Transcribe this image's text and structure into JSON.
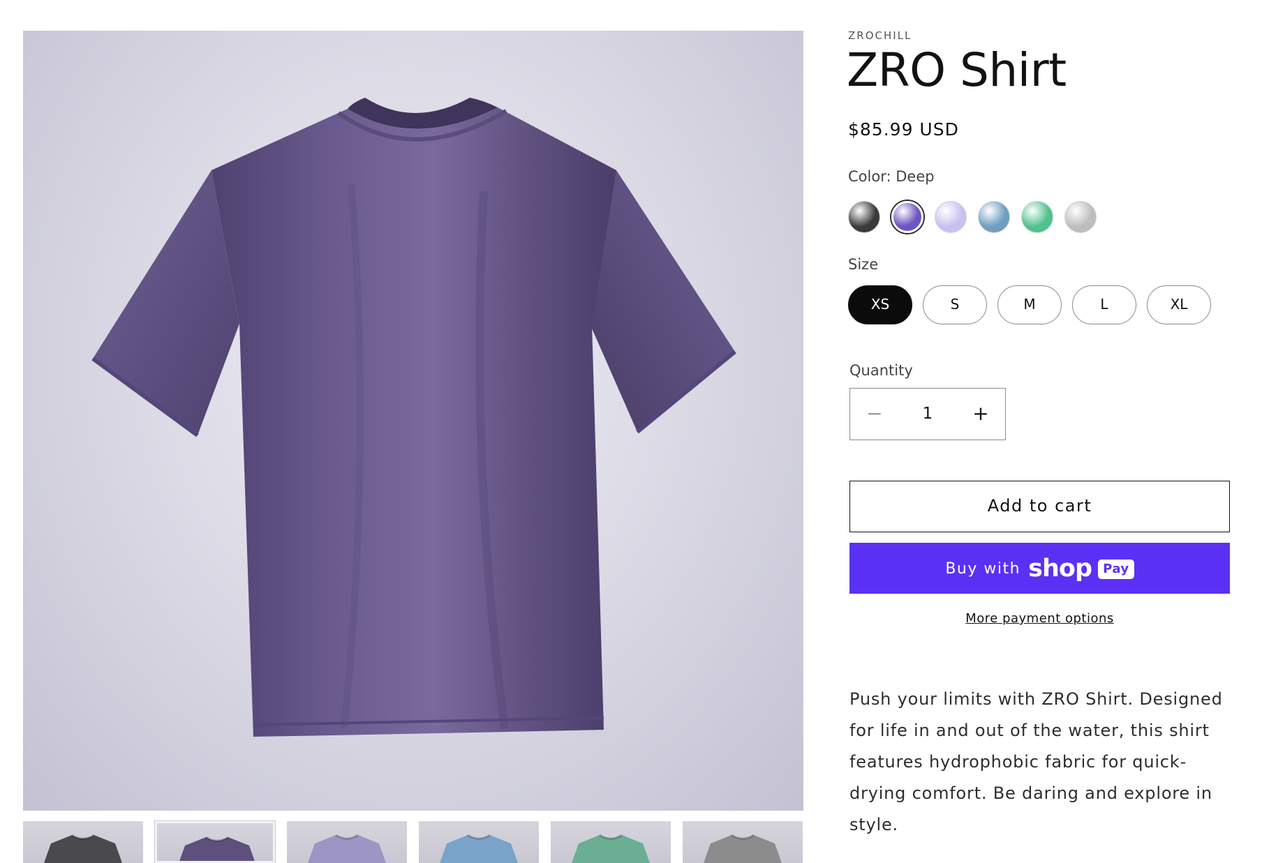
{
  "product": {
    "vendor": "ZROCHILL",
    "title": "ZRO Shirt",
    "price": "$85.99 USD",
    "color_label": "Color:",
    "color_selected": "Deep",
    "swatches": [
      {
        "name": "black",
        "color": "#3a3a3a"
      },
      {
        "name": "deep",
        "color": "#6f55c4",
        "selected": true
      },
      {
        "name": "lavender",
        "color": "#c8c0f0"
      },
      {
        "name": "blue",
        "color": "#6f9ebf"
      },
      {
        "name": "green",
        "color": "#4fc28f"
      },
      {
        "name": "gray",
        "color": "#bdbdbd"
      }
    ],
    "size_label": "Size",
    "sizes": [
      "XS",
      "S",
      "M",
      "L",
      "XL"
    ],
    "size_selected": "XS",
    "quantity_label": "Quantity",
    "quantity": "1",
    "minus_symbol": "−",
    "plus_symbol": "+",
    "add_to_cart": "Add to cart",
    "buy_with": "Buy with",
    "shop_word": "shop",
    "pay_badge": "Pay",
    "more_payment": "More payment options",
    "description": "Push your limits with ZRO Shirt. Designed for life in and out of the water, this shirt features hydrophobic fabric for quick-drying comfort. Be daring and explore in style."
  },
  "gallery": {
    "main_shirt_color": "#6c5a8c",
    "thumbs": [
      {
        "name": "black",
        "color": "#4a4a4e"
      },
      {
        "name": "deep",
        "color": "#5e4f7d",
        "selected": true
      },
      {
        "name": "lavender",
        "color": "#9d96c4"
      },
      {
        "name": "blue",
        "color": "#7aa3c9"
      },
      {
        "name": "green",
        "color": "#6aae93"
      },
      {
        "name": "gray",
        "color": "#8c8c8c"
      }
    ]
  },
  "colors": {
    "shop_pay": "#5a31f4",
    "selected_size_bg": "#0b0b0b"
  }
}
